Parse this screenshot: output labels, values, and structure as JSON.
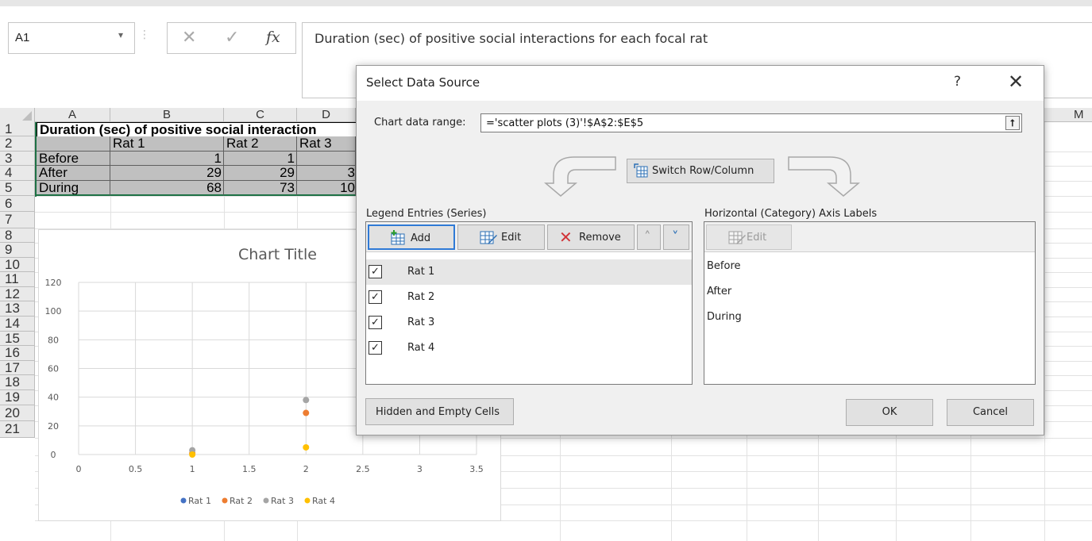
{
  "formula_bar": {
    "name_box": "A1",
    "name_box_arrow": "▾",
    "dots": "⋮",
    "cancel_glyph": "✕",
    "enter_glyph": "✓",
    "fx_glyph": "fx",
    "formula": "Duration (sec) of positive social interactions for each focal rat"
  },
  "sheet": {
    "columns": [
      "A",
      "B",
      "C",
      "D"
    ],
    "extra_column": "M",
    "rows": [
      "1",
      "2",
      "3",
      "4",
      "5",
      "6",
      "7",
      "8",
      "9",
      "10",
      "11",
      "12",
      "13",
      "14",
      "15",
      "16",
      "17",
      "18",
      "19",
      "20",
      "21"
    ],
    "title_cell": "Duration (sec) of positive social interaction",
    "headers": [
      "Rat 1",
      "Rat 2",
      "Rat 3"
    ],
    "row_labels": [
      "Before",
      "After",
      "During"
    ],
    "b_values": [
      "1",
      "29",
      "68"
    ],
    "c_values": [
      "1",
      "29",
      "73"
    ],
    "d_values": [
      "",
      "3",
      "10"
    ]
  },
  "chart": {
    "title": "Chart Title",
    "legend": [
      "Rat 1",
      "Rat 2",
      "Rat 3",
      "Rat 4"
    ]
  },
  "chart_data": {
    "type": "scatter",
    "title": "Chart Title",
    "xlim": [
      0,
      3.5
    ],
    "ylim": [
      0,
      120
    ],
    "x_ticks": [
      "0",
      "0.5",
      "1",
      "1.5",
      "2",
      "2.5",
      "3",
      "3.5"
    ],
    "y_ticks": [
      "0",
      "20",
      "40",
      "60",
      "80",
      "100",
      "120"
    ],
    "grid": true,
    "legend_position": "bottom",
    "series": [
      {
        "name": "Rat 1",
        "color": "#4472c4",
        "points": []
      },
      {
        "name": "Rat 2",
        "color": "#ed7d31",
        "points": [
          [
            1,
            1
          ],
          [
            2,
            29
          ]
        ]
      },
      {
        "name": "Rat 3",
        "color": "#a5a5a5",
        "points": [
          [
            1,
            3
          ],
          [
            2,
            38
          ]
        ]
      },
      {
        "name": "Rat 4",
        "color": "#ffc000",
        "points": [
          [
            1,
            0
          ],
          [
            2,
            5
          ]
        ]
      }
    ]
  },
  "dialog": {
    "title": "Select Data Source",
    "help": "?",
    "close": "✕",
    "range_label": "Chart data range:",
    "range_value": "='scatter plots (3)'!$A$2:$E$5",
    "range_collapse": "⭡",
    "switch_label": "Switch Row/Column",
    "legend_label": "Legend Entries (Series)",
    "axis_label": "Horizontal (Category) Axis Labels",
    "add_label": "Add",
    "edit_label": "Edit",
    "remove_label": "Remove",
    "remove_glyph": "✕",
    "up_glyph": "˄",
    "down_glyph": "˅",
    "check_glyph": "✓",
    "series": [
      "Rat 1",
      "Rat 2",
      "Rat 3",
      "Rat 4"
    ],
    "axis_edit_label": "Edit",
    "axis_items": [
      "Before",
      "After",
      "During"
    ],
    "hidden_label": "Hidden and Empty Cells",
    "ok_label": "OK",
    "cancel_label": "Cancel"
  }
}
